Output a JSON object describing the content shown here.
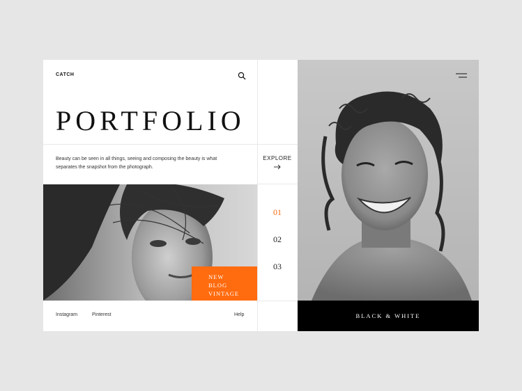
{
  "brand": "CATCH",
  "title": "PORTFOLIO",
  "description": "Beauty can be seen in all things, seeing and composing the beauty is what separates the snapshot from the photograph.",
  "explore": {
    "label": "EXPLORE",
    "icon": "arrow-right-icon"
  },
  "tag": {
    "line1": "NEW",
    "line2": "BLOG",
    "line3": "VINTAGE",
    "color": "#ff6b0f"
  },
  "pagination": [
    {
      "label": "01",
      "active": true
    },
    {
      "label": "02",
      "active": false
    },
    {
      "label": "03",
      "active": false
    }
  ],
  "footer": {
    "links": [
      "Instagram",
      "Pinterest"
    ],
    "help": "Help"
  },
  "banner": {
    "label": "BLACK & WHITE"
  },
  "icons": {
    "search": "search-icon",
    "menu": "hamburger-menu-icon"
  },
  "colors": {
    "accent": "#ff6b0f",
    "background": "#e6e6e6",
    "card": "#ffffff",
    "banner": "#000000"
  }
}
